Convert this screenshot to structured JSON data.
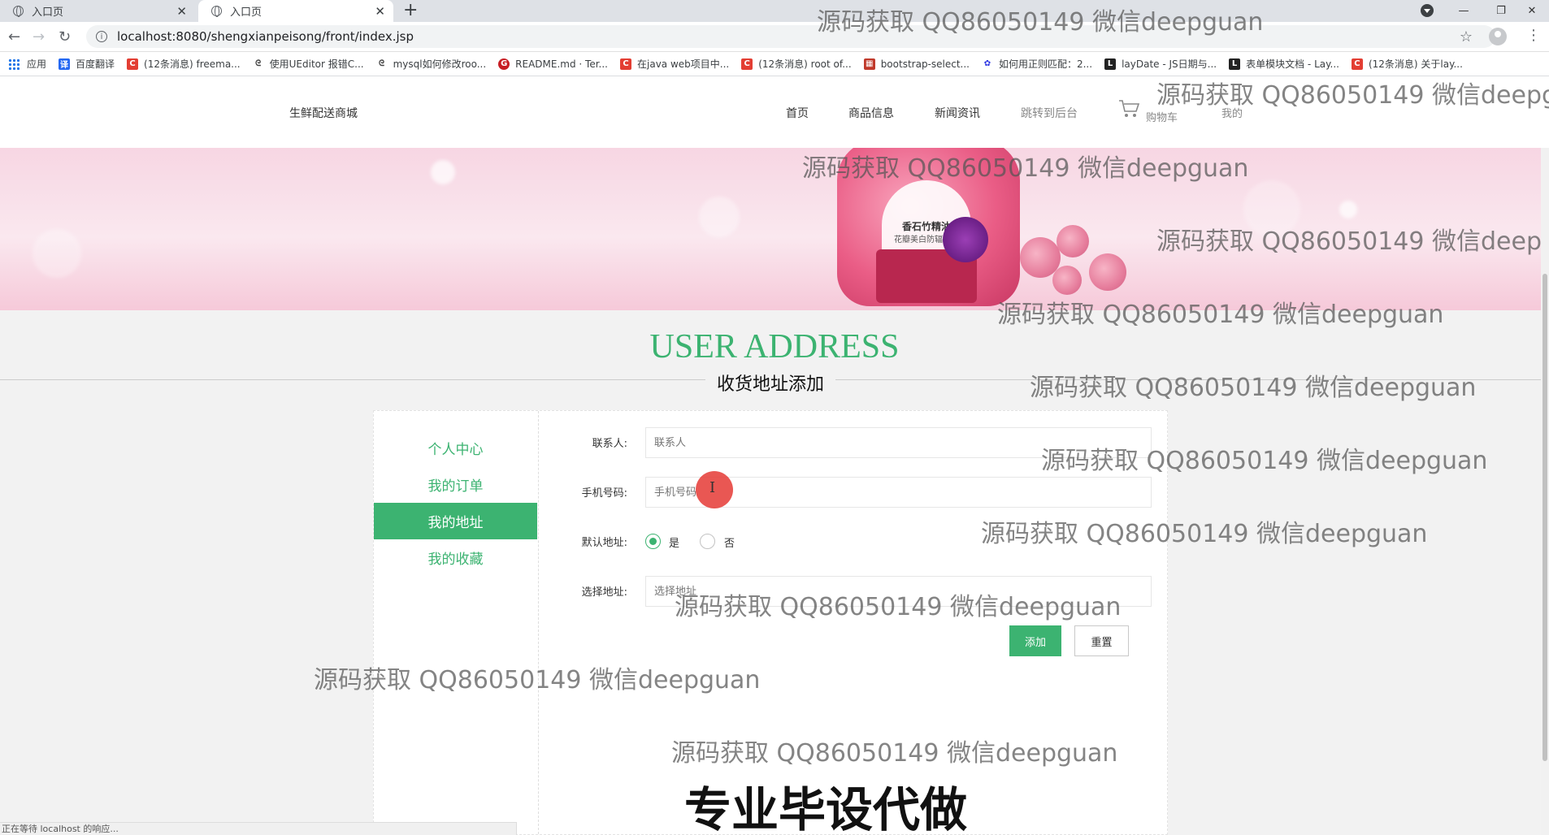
{
  "browser": {
    "tabs": [
      {
        "title": "入口页",
        "active": false
      },
      {
        "title": "入口页",
        "active": true
      }
    ],
    "url": "localhost:8080/shengxianpeisong/front/index.jsp",
    "bookmarks": [
      {
        "label": "应用",
        "icon": "apps-grid-icon",
        "color": "#1a73e8"
      },
      {
        "label": "百度翻译",
        "icon": "baidu-translate-icon",
        "color": "#2468f2"
      },
      {
        "label": "(12条消息) freema...",
        "icon": "csdn-icon",
        "color": "#e33e33"
      },
      {
        "label": "使用UEditor 报错C...",
        "icon": "link-icon",
        "color": "#444444"
      },
      {
        "label": "mysql如何修改roo...",
        "icon": "link-icon",
        "color": "#444444"
      },
      {
        "label": "README.md · Ter...",
        "icon": "gitee-icon",
        "color": "#c71d23"
      },
      {
        "label": "在java web项目中...",
        "icon": "csdn-icon",
        "color": "#e33e33"
      },
      {
        "label": "(12条消息) root of...",
        "icon": "csdn-icon",
        "color": "#e33e33"
      },
      {
        "label": "bootstrap-select...",
        "icon": "bootstrap-icon",
        "color": "#c0392b"
      },
      {
        "label": "如何用正则匹配：2...",
        "icon": "baidu-paw-icon",
        "color": "#2932e1"
      },
      {
        "label": "layDate - JS日期与...",
        "icon": "layui-icon",
        "color": "#222222"
      },
      {
        "label": "表单模块文档 - Lay...",
        "icon": "layui-icon",
        "color": "#222222"
      },
      {
        "label": "(12条消息) 关于lay...",
        "icon": "csdn-icon",
        "color": "#e33e33"
      }
    ]
  },
  "site": {
    "logo": "生鲜配送商城",
    "nav": [
      "首页",
      "商品信息",
      "新闻资讯",
      "跳转到后台"
    ],
    "cart_label": "购物车",
    "my_label": "我的"
  },
  "banner": {
    "product_title": "香石竹精油",
    "product_sub": "花瓣美白防辐面膜"
  },
  "page": {
    "title_en": "USER ADDRESS",
    "title_cn": "收货地址添加"
  },
  "sidebar": {
    "items": [
      {
        "label": "个人中心",
        "active": false
      },
      {
        "label": "我的订单",
        "active": false
      },
      {
        "label": "我的地址",
        "active": true
      },
      {
        "label": "我的收藏",
        "active": false
      }
    ]
  },
  "form": {
    "contact_label": "联系人:",
    "contact_placeholder": "联系人",
    "phone_label": "手机号码:",
    "phone_placeholder": "手机号码",
    "default_label": "默认地址:",
    "default_yes": "是",
    "default_no": "否",
    "default_selected": "是",
    "address_label": "选择地址:",
    "address_placeholder": "选择地址",
    "add_button": "添加",
    "reset_button": "重置"
  },
  "overlay": {
    "watermark": "源码获取 QQ86050149 微信deepguan",
    "promo": "专业毕设代做",
    "status": "正在等待 localhost 的响应..."
  },
  "colors": {
    "accent": "#3cb371",
    "tabbar": "#dee1e6"
  }
}
